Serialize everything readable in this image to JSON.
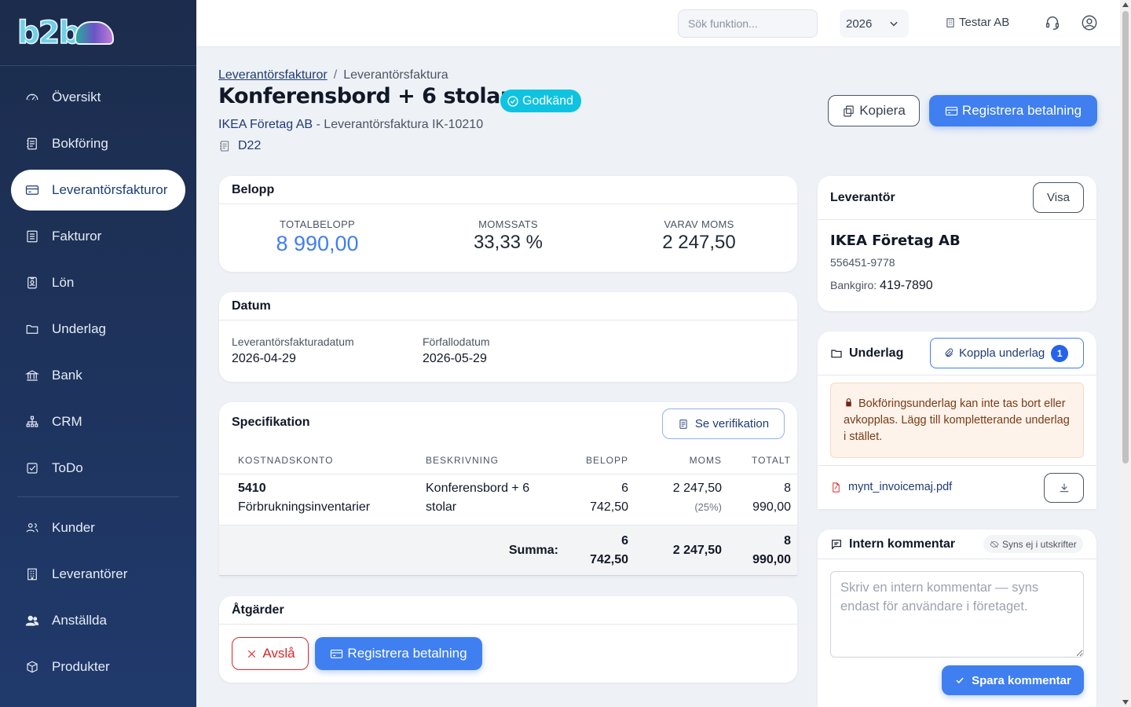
{
  "app": {
    "logo": "b2b"
  },
  "sidebar": {
    "items": [
      {
        "label": "Översikt",
        "icon": "gauge-icon"
      },
      {
        "label": "Bokföring",
        "icon": "ledger-icon"
      },
      {
        "label": "Leverantörsfakturor",
        "icon": "credit-card-icon",
        "active": true
      },
      {
        "label": "Fakturor",
        "icon": "invoice-icon"
      },
      {
        "label": "Lön",
        "icon": "id-badge-icon"
      },
      {
        "label": "Underlag",
        "icon": "folder-icon"
      },
      {
        "label": "Bank",
        "icon": "bank-icon"
      },
      {
        "label": "CRM",
        "icon": "org-chart-icon"
      },
      {
        "label": "ToDo",
        "icon": "checkbox-icon"
      },
      {
        "label": "Kunder",
        "icon": "users-icon"
      },
      {
        "label": "Leverantörer",
        "icon": "building-icon"
      },
      {
        "label": "Anställda",
        "icon": "people-icon"
      },
      {
        "label": "Produkter",
        "icon": "box-icon"
      }
    ]
  },
  "topbar": {
    "search_placeholder": "Sök funktion...",
    "year": "2026",
    "company": "Testar AB"
  },
  "header": {
    "breadcrumb_link": "Leverantörsfakturor",
    "breadcrumb_sep": "/",
    "breadcrumb_current": "Leverantörsfaktura",
    "title": "Konferensbord + 6 stolar",
    "status": "Godkänd",
    "supplier": "IKEA Företag AB",
    "subtitle_rest": " - Leverantörsfaktura IK-10210",
    "verification": "D22",
    "copy_label": "Kopiera",
    "register_label": "Registrera betalning"
  },
  "amount": {
    "title": "Belopp",
    "total_label": "TOTALBELOPP",
    "total": "8 990,00",
    "vat_rate_label": "MOMSSATS",
    "vat_rate": "33,33 %",
    "vat_label": "VARAV MOMS",
    "vat": "2 247,50"
  },
  "dates": {
    "title": "Datum",
    "invoice_date_label": "Leverantörsfakturadatum",
    "invoice_date": "2026-04-29",
    "due_date_label": "Förfallodatum",
    "due_date": "2026-05-29"
  },
  "spec": {
    "title": "Specifikation",
    "see_verification": "Se verifikation",
    "headers": [
      "KOSTNADSKONTO",
      "BESKRIVNING",
      "BELOPP",
      "MOMS",
      "TOTALT"
    ],
    "rows": [
      {
        "account": "5410",
        "account_name": "Förbrukningsinventarier",
        "desc1": "Konferensbord + 6",
        "desc2": "stolar",
        "amount1": "6",
        "amount2": "742,50",
        "vat": "2 247,50",
        "vat_rate": "(25%)",
        "total1": "8",
        "total2": "990,00"
      }
    ],
    "sum_label": "Summa:",
    "sum_amount1": "6",
    "sum_amount2": "742,50",
    "sum_vat": "2 247,50",
    "sum_total1": "8",
    "sum_total2": "990,00"
  },
  "actions": {
    "title": "Åtgärder",
    "reject": "Avslå",
    "register": "Registrera betalning"
  },
  "supplier_card": {
    "title": "Leverantör",
    "show": "Visa",
    "name": "IKEA Företag AB",
    "org_no": "556451-9778",
    "bankgiro_label": "Bankgiro:",
    "bankgiro": "419-7890"
  },
  "attachments": {
    "title": "Underlag",
    "link_label": "Koppla underlag",
    "count": "1",
    "warning": "Bokföringsunderlag kan inte tas bort eller avkopplas. Lägg till kompletterande underlag i stället.",
    "file": "mynt_invoicemaj.pdf"
  },
  "comment": {
    "title": "Intern kommentar",
    "hint": "Syns ej i utskrifter",
    "placeholder": "Skriv en intern kommentar — syns endast för användare i företaget.",
    "save": "Spara kommentar"
  },
  "colors": {
    "primary": "#3f7ff0",
    "sidebar": "#1c2c4c",
    "status_badge": "#0fc3e0",
    "warning_bg": "#fdf3ea"
  }
}
